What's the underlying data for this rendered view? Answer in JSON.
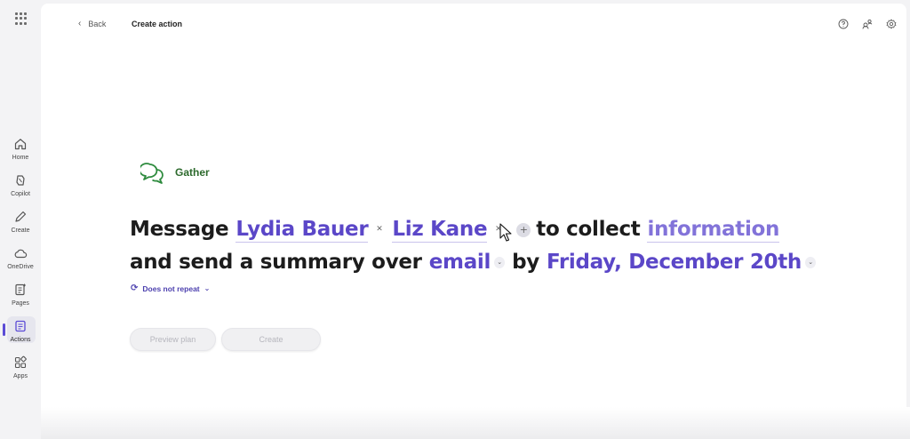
{
  "header": {
    "back_label": "Back",
    "title": "Create action"
  },
  "top_icons": [
    "help-icon",
    "share-people-icon",
    "settings-icon"
  ],
  "nav": {
    "items": [
      {
        "label": "Home",
        "icon": "home-icon"
      },
      {
        "label": "Copilot",
        "icon": "copilot-icon"
      },
      {
        "label": "Create",
        "icon": "pen-icon"
      },
      {
        "label": "OneDrive",
        "icon": "cloud-icon"
      },
      {
        "label": "Pages",
        "icon": "pages-icon"
      },
      {
        "label": "Actions",
        "icon": "actions-icon",
        "active": true
      },
      {
        "label": "Apps",
        "icon": "apps-icon"
      }
    ]
  },
  "action": {
    "category": "Gather",
    "line1": {
      "prefix": "Message",
      "recipients": [
        "Lydia Bauer",
        "Liz Kane"
      ],
      "middle": "to collect",
      "topic": "information"
    },
    "line2": {
      "prefix": "and send a summary over",
      "channel": "email",
      "middle": "by",
      "due": "Friday, December 20th"
    },
    "repeat_label": "Does not repeat"
  },
  "buttons": {
    "preview": "Preview plan",
    "create": "Create"
  },
  "colors": {
    "accent": "#5b47c8",
    "gather_green": "#2d6a2d"
  }
}
